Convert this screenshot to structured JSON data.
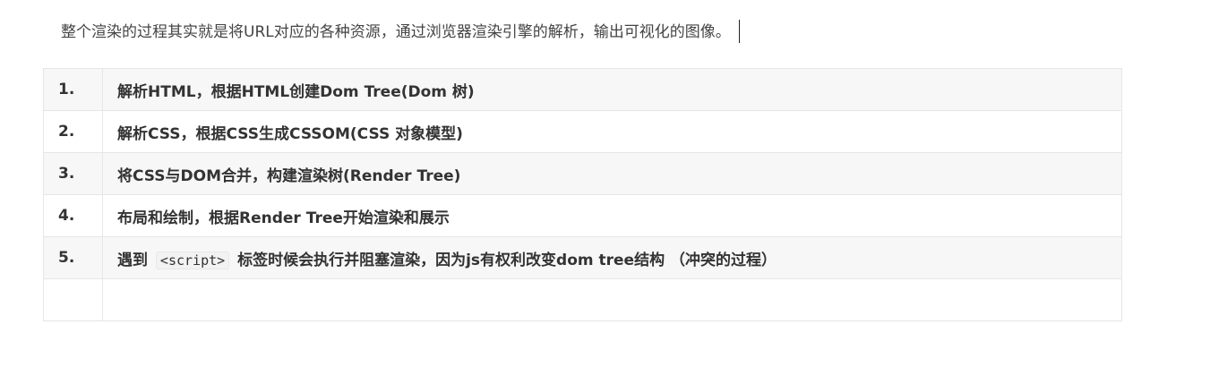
{
  "intro": "整个渲染的过程其实就是将URL对应的各种资源，通过浏览器渲染引擎的解析，输出可视化的图像。",
  "steps": [
    {
      "num": "1.",
      "text": "解析HTML，根据HTML创建Dom Tree(Dom 树)"
    },
    {
      "num": "2.",
      "text": "解析CSS，根据CSS生成CSSOM(CSS 对象模型)"
    },
    {
      "num": "3.",
      "text": "将CSS与DOM合并，构建渲染树(Render Tree)"
    },
    {
      "num": "4.",
      "text": "布局和绘制，根据Render Tree开始渲染和展示"
    },
    {
      "num": "5.",
      "text_before": "遇到",
      "code": "<script>",
      "text_after": "标签时候会执行并阻塞渲染，因为js有权利改变dom tree结构 （冲突的过程）"
    },
    {
      "num": "",
      "text": ""
    }
  ]
}
